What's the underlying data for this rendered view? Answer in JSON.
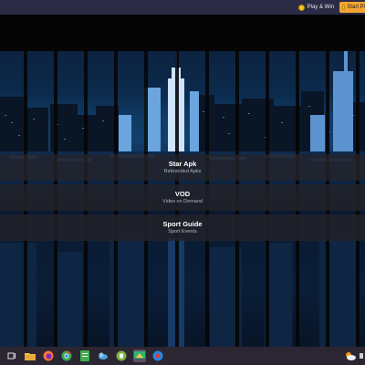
{
  "topbar": {
    "play_win_label": "Play & Win",
    "start_button_label": "Start Pl"
  },
  "menu": {
    "items": [
      {
        "title": "Star Apk",
        "subtitle": "Rebranded Apks"
      },
      {
        "title": "VOD",
        "subtitle": "Video on Demand"
      },
      {
        "title": "Sport Guide",
        "subtitle": "Sport Events"
      }
    ]
  },
  "taskbar": {
    "icons": [
      "task-view-icon",
      "file-explorer-icon",
      "firefox-icon",
      "chrome-icon",
      "app-icon",
      "weather-app-icon",
      "android-icon",
      "emulator-icon",
      "browser-icon"
    ],
    "active_icon": "emulator-icon"
  },
  "colors": {
    "topbar": "#2b2b45",
    "accent": "#f3a531",
    "taskbar": "#2c2532",
    "menu_item_bg": "#23232a"
  }
}
